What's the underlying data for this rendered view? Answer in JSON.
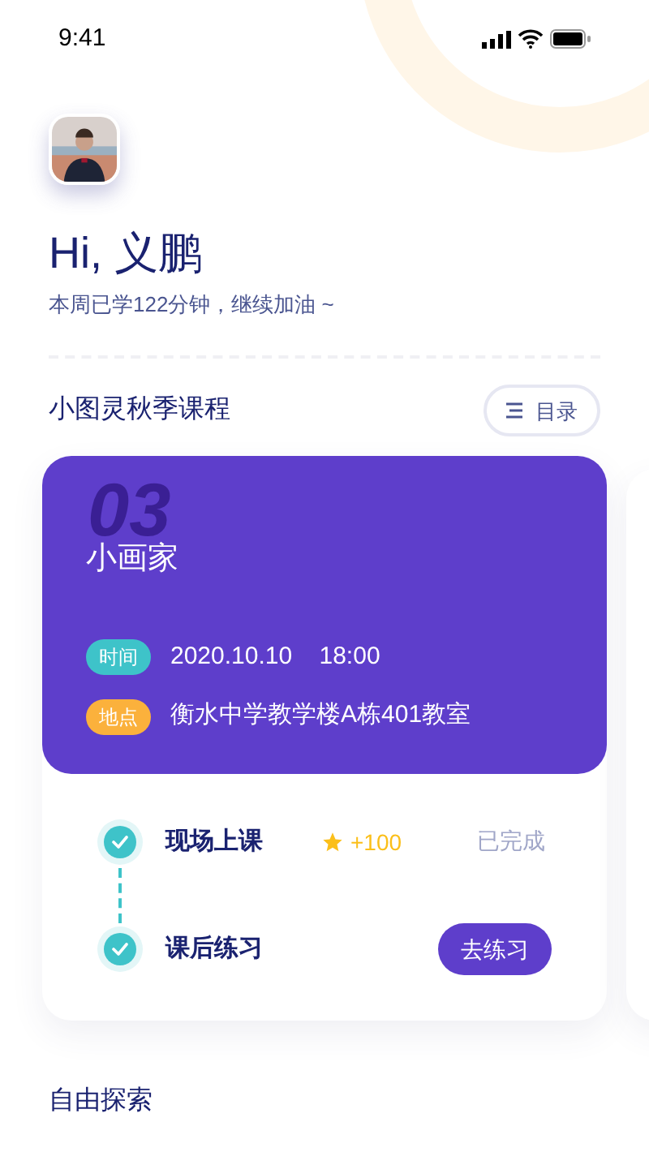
{
  "status_bar": {
    "time": "9:41"
  },
  "greeting": {
    "title": "Hi, 义鹏",
    "subtitle": "本周已学122分钟，继续加油 ~"
  },
  "course_section": {
    "title": "小图灵秋季课程",
    "catalog_button": "目录"
  },
  "lesson_card": {
    "number": "03",
    "title": "小画家",
    "details": [
      {
        "tag": "时间",
        "color": "#3ec3c9",
        "value": "2020.10.10    18:00"
      },
      {
        "tag": "地点",
        "color": "#fbb13c",
        "value": "衡水中学教学楼A栋401教室"
      }
    ],
    "steps": [
      {
        "label": "现场上课",
        "checked": true,
        "reward": "+100",
        "kind": "status",
        "status": "已完成"
      },
      {
        "label": "课后练习",
        "checked": true,
        "kind": "action",
        "action": "去练习"
      }
    ]
  },
  "explore_section": {
    "title": "自由探索"
  }
}
